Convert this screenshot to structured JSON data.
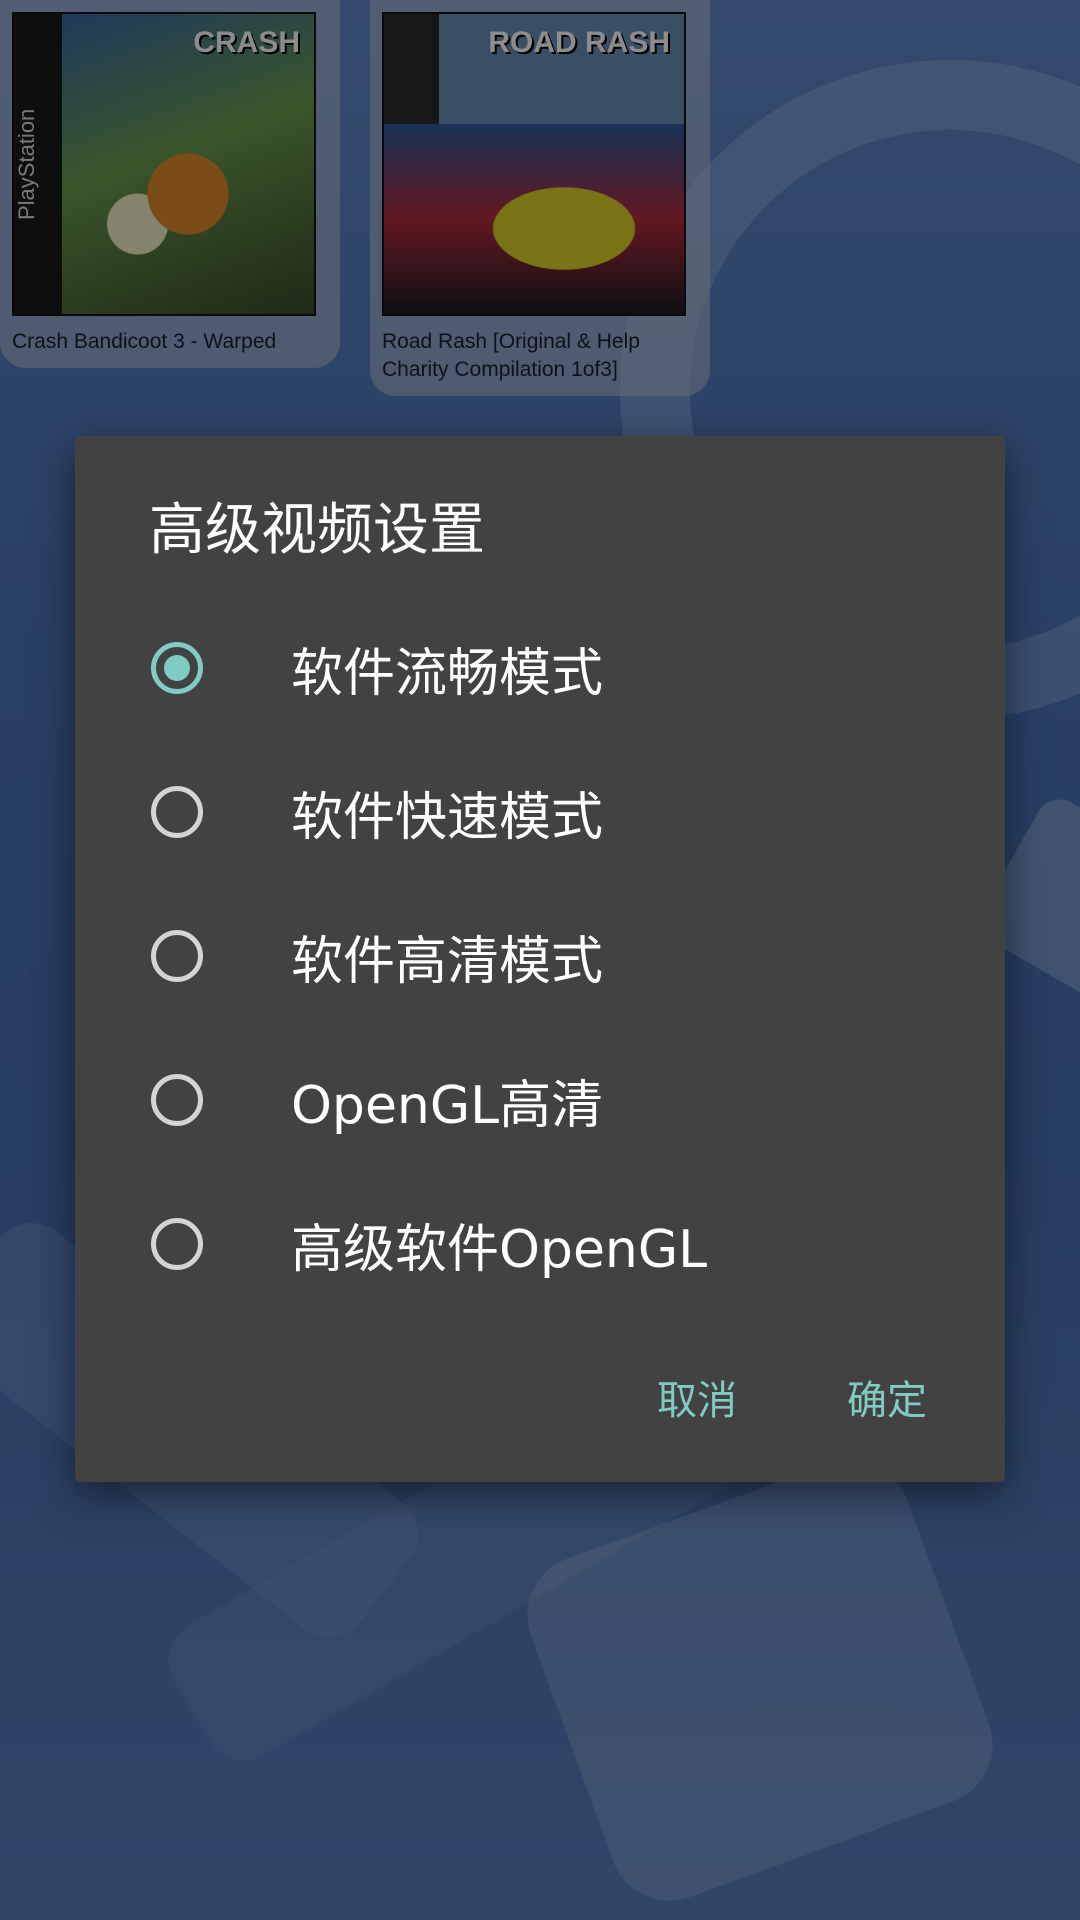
{
  "games": [
    {
      "title": "Crash Bandicoot 3 - Warped",
      "cover_spine": "PlayStation",
      "cover_logo": "CRASH"
    },
    {
      "title": "Road Rash [Original & Help Charity Compilation 1of3]",
      "cover_logo": "ROAD RASH"
    }
  ],
  "dialog": {
    "title": "高级视频设置",
    "options": [
      {
        "label": "软件流畅模式",
        "selected": true
      },
      {
        "label": "软件快速模式",
        "selected": false
      },
      {
        "label": "软件高清模式",
        "selected": false
      },
      {
        "label": "OpenGL高清",
        "selected": false
      },
      {
        "label": "高级软件OpenGL",
        "selected": false
      }
    ],
    "cancel_label": "取消",
    "confirm_label": "确定",
    "accent_color": "#80cbc4",
    "background_color": "#424242"
  }
}
